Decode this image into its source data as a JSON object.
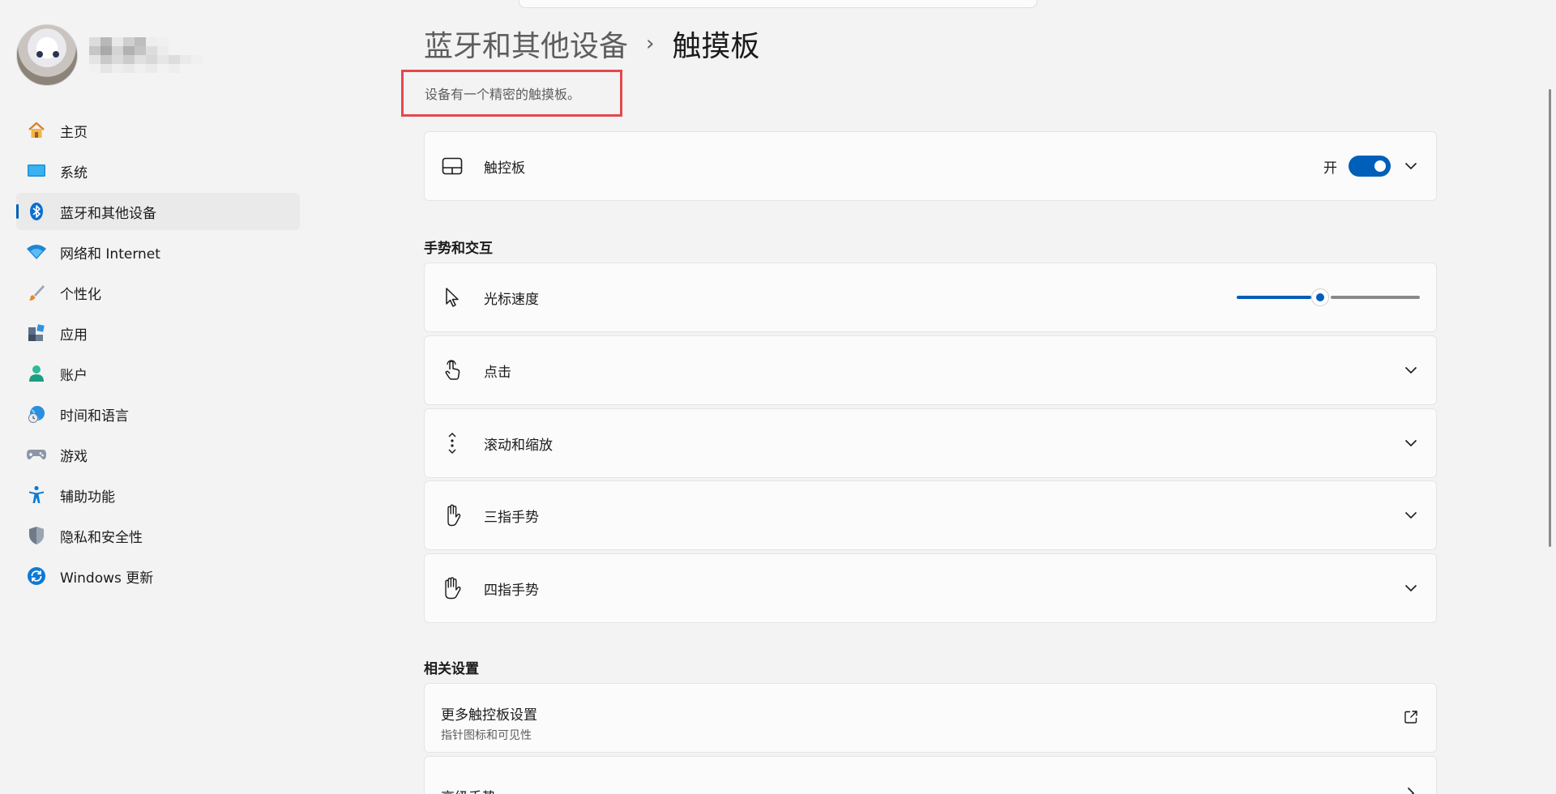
{
  "breadcrumb": {
    "parent": "蓝牙和其他设备",
    "separator": "›",
    "current": "触摸板"
  },
  "description": "设备有一个精密的触摸板。",
  "nav": [
    {
      "label": "主页"
    },
    {
      "label": "系统"
    },
    {
      "label": "蓝牙和其他设备",
      "active": true
    },
    {
      "label": "网络和 Internet"
    },
    {
      "label": "个性化"
    },
    {
      "label": "应用"
    },
    {
      "label": "账户"
    },
    {
      "label": "时间和语言"
    },
    {
      "label": "游戏"
    },
    {
      "label": "辅助功能"
    },
    {
      "label": "隐私和安全性"
    },
    {
      "label": "Windows 更新"
    }
  ],
  "touchpad": {
    "label": "触控板",
    "state_text": "开",
    "enabled": true
  },
  "gestures": {
    "title": "手势和交互",
    "cursor_speed": {
      "label": "光标速度",
      "value_fraction": 0.45
    },
    "items": [
      {
        "label": "点击"
      },
      {
        "label": "滚动和缩放"
      },
      {
        "label": "三指手势"
      },
      {
        "label": "四指手势"
      }
    ]
  },
  "related": {
    "title": "相关设置",
    "more": {
      "title": "更多触控板设置",
      "subtitle": "指针图标和可见性"
    },
    "advanced": {
      "title": "高级手势"
    }
  },
  "colors": {
    "accent": "#005fb8",
    "highlight_border": "#e5484d"
  }
}
